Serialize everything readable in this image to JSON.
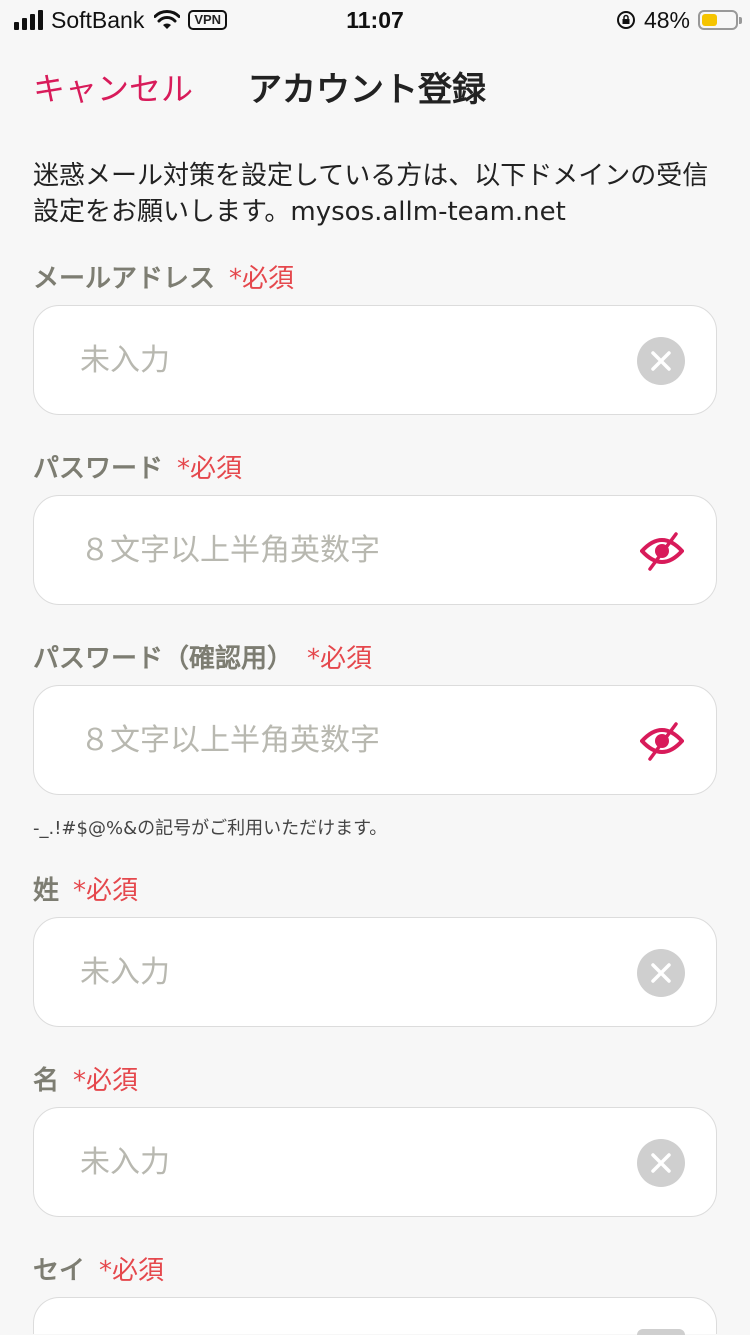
{
  "status_bar": {
    "carrier": "SoftBank",
    "vpn": "VPN",
    "time": "11:07",
    "battery_percent": "48%",
    "battery_level": 0.48,
    "signal_bars": 4,
    "icons": [
      "signal-icon",
      "wifi-icon",
      "orientation-lock-icon",
      "battery-icon"
    ]
  },
  "nav": {
    "cancel_label": "キャンセル",
    "title": "アカウント登録"
  },
  "notice": "迷惑メール対策を設定している方は、以下ドメインの受信設定をお願いします。mysos.allm-team.net",
  "required_mark": "*必須",
  "fields": {
    "email": {
      "label": "メールアドレス",
      "placeholder": "未入力",
      "value": ""
    },
    "password": {
      "label": "パスワード",
      "placeholder": "８文字以上半角英数字",
      "value": ""
    },
    "password_confirm": {
      "label": "パスワード（確認用）",
      "placeholder": "８文字以上半角英数字",
      "value": ""
    },
    "last_name": {
      "label": "姓",
      "placeholder": "未入力",
      "value": ""
    },
    "first_name": {
      "label": "名",
      "placeholder": "未入力",
      "value": ""
    },
    "last_name_kana": {
      "label": "セイ"
    }
  },
  "password_hint": "-_.!#$@%&の記号がご利用いただけます。",
  "colors": {
    "accent": "#d81b5a",
    "required": "#e5484d",
    "label": "#7d7d72",
    "background": "#f7f7f7"
  }
}
